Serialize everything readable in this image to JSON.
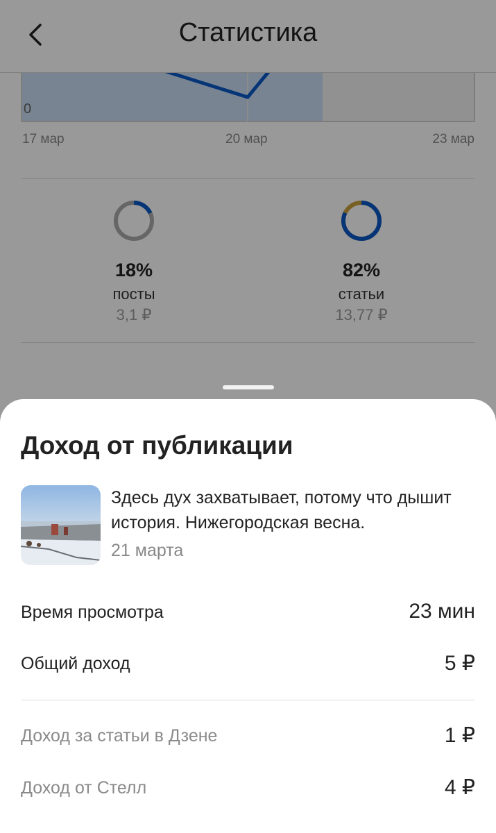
{
  "header": {
    "title": "Статистика"
  },
  "chart": {
    "zero_label": "0",
    "ticks": [
      "17 мар",
      "20 мар",
      "23 мар"
    ]
  },
  "stats": [
    {
      "percent": "18%",
      "value": 18,
      "label": "посты",
      "amount": "3,1 ₽",
      "color": "#0b59c7"
    },
    {
      "percent": "82%",
      "value": 82,
      "label": "статьи",
      "amount": "13,77 ₽",
      "color": "#0b59c7"
    }
  ],
  "colors": {
    "accent": "#0b59c7",
    "ring_track": "#aaaaaa",
    "articles_other": "#c8a13b"
  },
  "sheet": {
    "title": "Доход от публикации",
    "publication": {
      "text": "Здесь дух захватывает, потому что дышит история. Нижегородская весна.",
      "date": "21 марта"
    },
    "rows": [
      {
        "label": "Время просмотра",
        "value": "23 мин"
      },
      {
        "label": "Общий доход",
        "value": "5 ₽"
      }
    ],
    "breakdown": [
      {
        "label": "Доход за статьи в Дзене",
        "value": "1 ₽"
      },
      {
        "label": "Доход от Стелл",
        "value": "4 ₽"
      }
    ]
  }
}
